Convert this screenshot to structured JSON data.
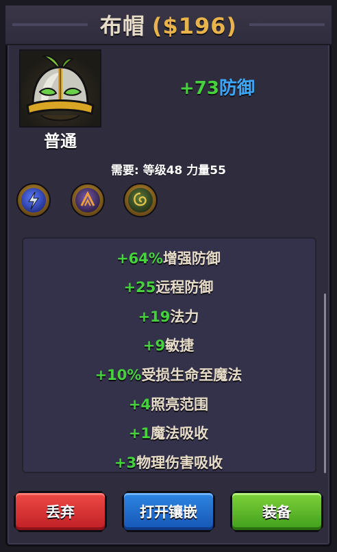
{
  "item": {
    "name": "布帽",
    "price": "($196)",
    "rarity": "普通",
    "main_stat_value": "+73",
    "main_stat_label": "防御",
    "requirement": "需要: 等级48 力量55",
    "icon": "helmet-icon"
  },
  "gems": [
    {
      "icon": "lightning-rune-icon",
      "color": "#3b5bd8"
    },
    {
      "icon": "arrow-rune-icon",
      "color": "#5a3a8a"
    },
    {
      "icon": "swirl-rune-icon",
      "color": "#3d5a2a"
    }
  ],
  "stats": [
    {
      "value": "+64%",
      "label": "增强防御"
    },
    {
      "value": "+25",
      "label": "远程防御"
    },
    {
      "value": "+19",
      "label": "法力"
    },
    {
      "value": "+9",
      "label": "敏捷"
    },
    {
      "value": "+10%",
      "label": "受损生命至魔法"
    },
    {
      "value": "+4",
      "label": "照亮范围"
    },
    {
      "value": "+1",
      "label": "魔法吸收"
    },
    {
      "value": "+3",
      "label": "物理伤害吸收"
    }
  ],
  "buttons": {
    "drop": "丢弃",
    "socket": "打开镶嵌",
    "equip": "装备"
  },
  "colors": {
    "stat_value": "#45d23c",
    "defense_label": "#3aa8ff",
    "price": "#e7b34a"
  }
}
